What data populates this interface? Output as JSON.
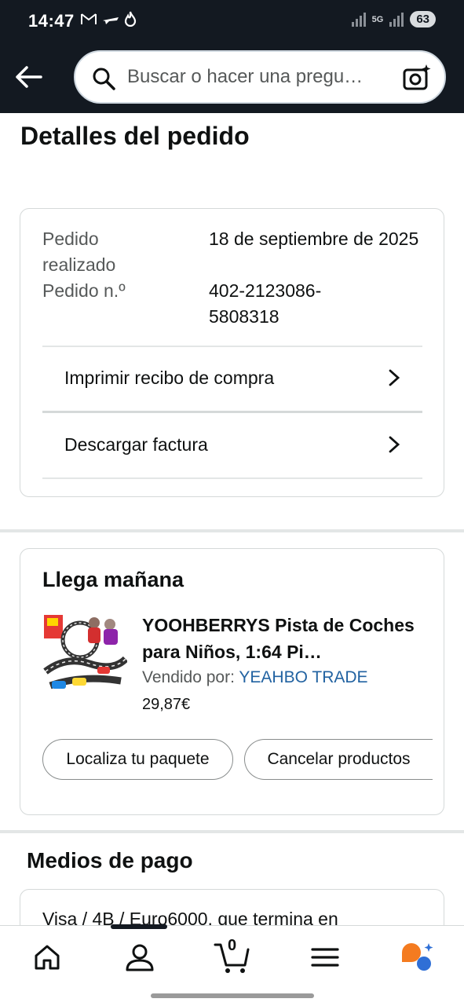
{
  "status_bar": {
    "time": "14:47",
    "notification_icons": [
      "gmail-icon",
      "airplane-icon",
      "fire-icon"
    ],
    "network": "5G",
    "battery": "63"
  },
  "header": {
    "search_placeholder": "Buscar o hacer una pregu…",
    "icons": [
      "back-arrow-icon",
      "search-icon",
      "camera-icon"
    ]
  },
  "page": {
    "title": "Detalles del pedido"
  },
  "order_details": {
    "placed_label": "Pedido realizado",
    "placed_value": "18 de septiembre de 2025",
    "number_label": "Pedido n.º",
    "number_value": "402-2123086-5808318",
    "links": [
      {
        "label": "Imprimir recibo de compra"
      },
      {
        "label": "Descargar factura"
      }
    ]
  },
  "shipment": {
    "title": "Llega mañana",
    "product_title": "YOOHBERRYS Pista de Coches para Niños, 1:64 Pi…",
    "seller_label": "Vendido por:",
    "seller_name": "YEAHBO TRADE",
    "price": "29,87€",
    "actions": [
      "Localiza tu paquete",
      "Cancelar productos"
    ]
  },
  "payment": {
    "title": "Medios de pago",
    "method": "Visa / 4B / Euro6000, que termina en"
  },
  "bottom_nav": {
    "items": [
      "home-icon",
      "account-icon",
      "cart-icon",
      "menu-icon",
      "rufus-icon"
    ],
    "cart_count": "0"
  },
  "colors": {
    "header_bg": "#131921",
    "link_blue": "#2162a1",
    "rufus_orange": "#f47b20",
    "rufus_blue": "#2f6fd6"
  }
}
